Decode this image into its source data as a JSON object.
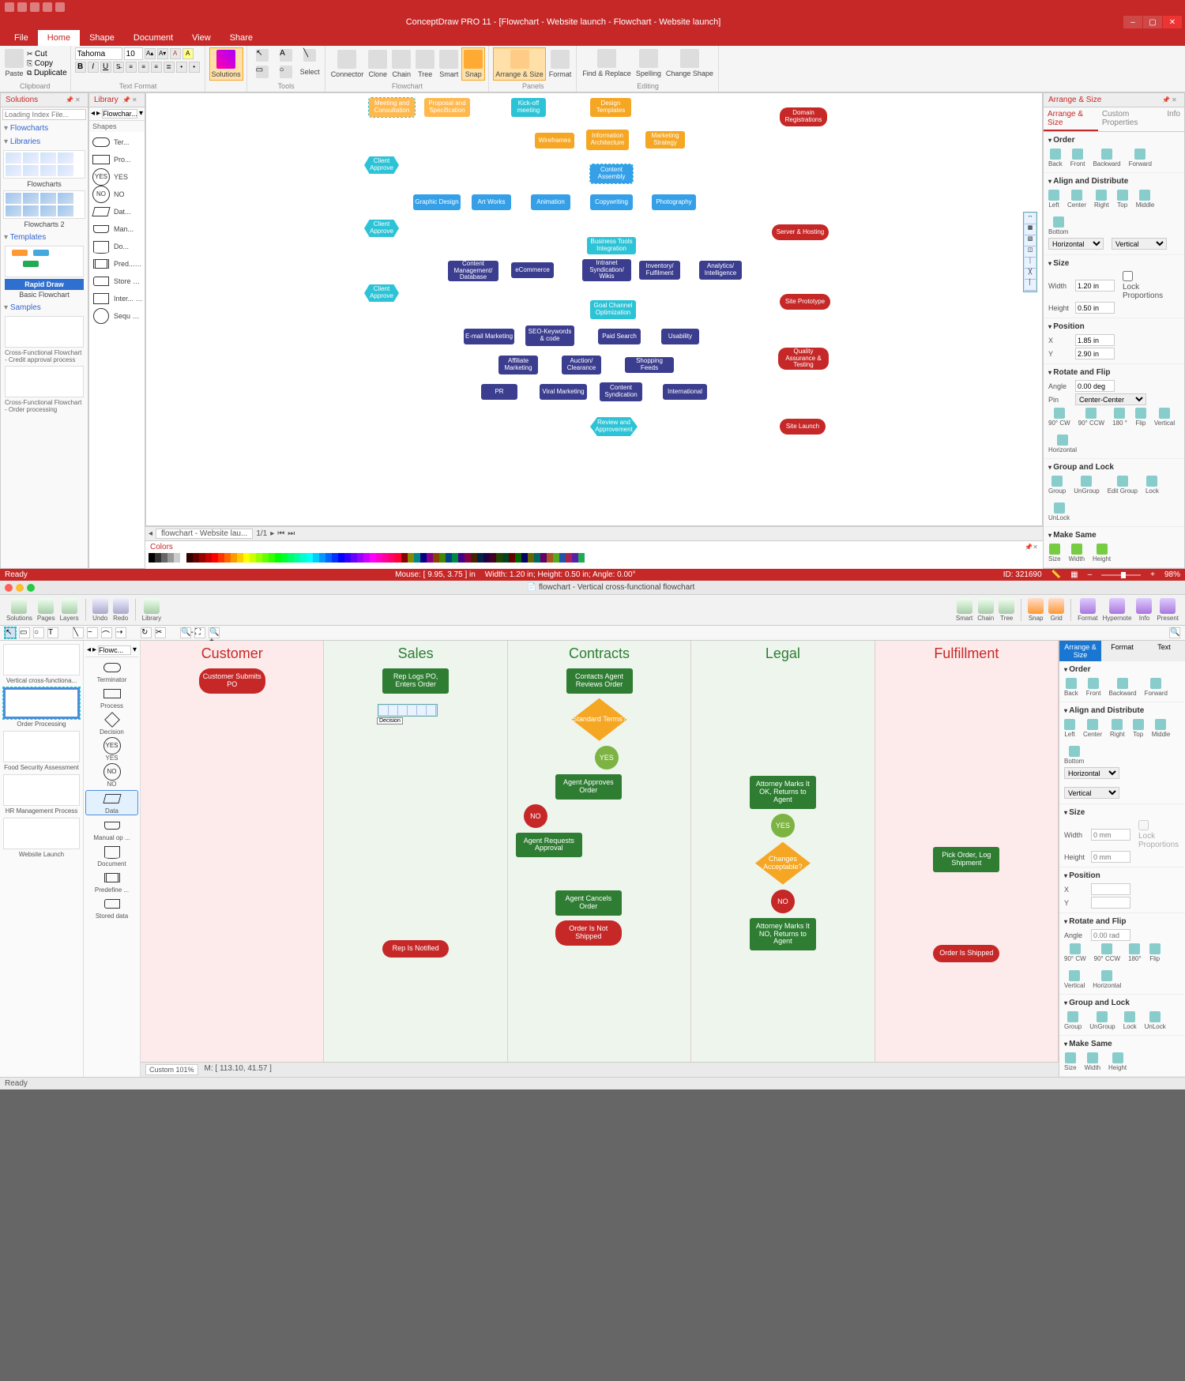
{
  "app1": {
    "title": "ConceptDraw PRO 11 - [Flowchart - Website launch - Flowchart - Website launch]",
    "qat": [
      "new",
      "open",
      "save",
      "undo",
      "redo"
    ],
    "tabs": [
      "File",
      "Home",
      "Shape",
      "Document",
      "View",
      "Share"
    ],
    "tab_active": "Home",
    "ribbon": {
      "paste": "Paste",
      "cut": "Cut",
      "copy": "Copy",
      "dup": "Duplicate",
      "clipboard": "Clipboard",
      "font_name": "Tahoma",
      "font_size": "10",
      "textformat": "Text Format",
      "solutions": "Solutions",
      "select": "Select",
      "tools": "Tools",
      "connector": "Connector",
      "clone": "Clone",
      "chain": "Chain",
      "tree": "Tree",
      "smart": "Smart",
      "snap": "Snap",
      "flowchart_grp": "Flowchart",
      "arrange": "Arrange & Size",
      "format": "Format",
      "panels": "Panels",
      "find": "Find & Replace",
      "spell": "Spelling",
      "change": "Change Shape",
      "editing": "Editing"
    },
    "solutions_panel": {
      "title": "Solutions",
      "search_ph": "Loading Index File...",
      "cat1": "Flowcharts",
      "cat2": "Libraries",
      "lib1": "Flowcharts",
      "lib2": "Flowcharts 2",
      "cat3": "Templates",
      "tpl1": "Basic Flowchart",
      "rapid": "Rapid Draw",
      "cat4": "Samples",
      "s1": "Cross-Functional Flowchart - Credit approval process",
      "s2": "Cross-Functional Flowchart - Order processing"
    },
    "library_panel": {
      "title": "Library",
      "filter": "Flowchar...",
      "shapes_tab": "Shapes",
      "sh": [
        "Ter...",
        "Pro...",
        "YES",
        "NO",
        "Dat...",
        "Man...",
        "Do...",
        "Pred... eff...",
        "Store d d...",
        "Inter... nal ...",
        "Sequ en..."
      ]
    },
    "flow": {
      "meeting": "Meeting and Consultation",
      "proposal": "Proposal and Specification",
      "kickoff": "Kick-off meeting",
      "design": "Design Templates",
      "wire": "Wireframes",
      "infoarch": "Information Architecture",
      "marketing": "Marketing Strategy",
      "domain": "Domain Registrations",
      "client": "Client Approve",
      "content": "Content Assembly",
      "graphic": "Graphic Design",
      "art": "Art Works",
      "anim": "Animation",
      "copy": "Copywriting",
      "photo": "Photography",
      "server": "Server & Hosting",
      "biztool": "Business Tools Integration",
      "cms": "Content Management/ Database",
      "ecom": "eCommerce",
      "intra": "Intranet Syndication/ Wikis",
      "inv": "Inventory/ Fulfilment",
      "analytics": "Analytics/ Intelligence",
      "goal": "Goal Channel Optimization",
      "siteproto": "Site Prototype",
      "email": "E-mail Marketing",
      "seo": "SEO-Keywords & code",
      "paid": "Paid Search",
      "usab": "Usability",
      "affil": "Affiliate Marketing",
      "auction": "Auction/ Clearance",
      "shop": "Shopping Feeds",
      "qat": "Quality Assurance & Testing",
      "pr": "PR",
      "viral": "Viral Marketing",
      "synd": "Content Syndication",
      "intl": "International",
      "review": "Review and Approvement",
      "launch": "Site Launch"
    },
    "doc_tab": "flowchart - Website lau...",
    "doc_page": "1/1",
    "colors": "Colors",
    "props": {
      "title": "Arrange & Size",
      "t1": "Arrange & Size",
      "t2": "Custom Properties",
      "t3": "Info",
      "order": "Order",
      "order_btns": [
        "Back",
        "Front",
        "Backward",
        "Forward"
      ],
      "align": "Align and Distribute",
      "al_btns": [
        "Left",
        "Center",
        "Right",
        "Top",
        "Middle",
        "Bottom"
      ],
      "horiz": "Horizontal",
      "vert": "Vertical",
      "size": "Size",
      "width": "Width",
      "width_v": "1.20 in",
      "height": "Height",
      "height_v": "0.50 in",
      "lock": "Lock Proportions",
      "pos": "Position",
      "x": "X",
      "x_v": "1.85 in",
      "y": "Y",
      "y_v": "2.90 in",
      "rot": "Rotate and Flip",
      "angle": "Angle",
      "angle_v": "0.00 deg",
      "pin": "Pin",
      "pin_v": "Center-Center",
      "rot_btns": [
        "90° CW",
        "90° CCW",
        "180 °",
        "Flip",
        "Vertical",
        "Horizontal"
      ],
      "grp": "Group and Lock",
      "grp_btns": [
        "Group",
        "UnGroup",
        "Edit Group",
        "Lock",
        "UnLock"
      ],
      "same": "Make Same",
      "same_btns": [
        "Size",
        "Width",
        "Height"
      ]
    },
    "status": {
      "ready": "Ready",
      "mouse": "Mouse: [ 9.95, 3.75 ] in",
      "dims": "Width: 1.20 in; Height: 0.50 in; Angle: 0.00°",
      "id": "ID: 321690",
      "zoom": "98%"
    }
  },
  "app2": {
    "title": "flowchart - Vertical cross-functional flowchart",
    "toolbar": [
      "Solutions",
      "Pages",
      "Layers",
      "Undo",
      "Redo",
      "Library",
      "Smart",
      "Chain",
      "Tree",
      "Snap",
      "Grid",
      "Format",
      "Hypernote",
      "Info",
      "Present"
    ],
    "sol": [
      "Vertical cross-functiona...",
      "Order Processing",
      "Food Security Assessment",
      "HR Management Process",
      "Website Launch"
    ],
    "lib_filter": "Flowc...",
    "shapes": [
      "Terminator",
      "Process",
      "Decision",
      "YES",
      "NO",
      "Data",
      "Manual op ...",
      "Document",
      "Predefine ...",
      "Stored data"
    ],
    "lanes": [
      "Customer",
      "Sales",
      "Contracts",
      "Legal",
      "Fulfillment"
    ],
    "nodes": {
      "submit": "Customer Submits PO",
      "replog": "Rep Logs PO, Enters Order",
      "contacts": "Contacts Agent Reviews Order",
      "std": "Standard Terms?",
      "decision_lbl": "Decision",
      "yes": "YES",
      "no": "NO",
      "approves": "Agent Approves Order",
      "markok": "Attorney Marks It OK, Returns to Agent",
      "requests": "Agent Requests Approval",
      "changes": "Changes Acceptable?",
      "pick": "Pick Order, Log Shipment",
      "cancels": "Agent Cancels Order",
      "markno": "Attorney Marks It NO, Returns to Agent",
      "repnot": "Rep Is Notified",
      "notship": "Order Is Not Shipped",
      "shipped": "Order Is Shipped"
    },
    "props": {
      "t1": "Arrange & Size",
      "t2": "Format",
      "t3": "Text",
      "order": "Order",
      "order_btns": [
        "Back",
        "Front",
        "Backward",
        "Forward"
      ],
      "align": "Align and Distribute",
      "al_btns": [
        "Left",
        "Center",
        "Right",
        "Top",
        "Middle",
        "Bottom"
      ],
      "horiz": "Horizontal",
      "vert": "Vertical",
      "size": "Size",
      "width": "Width",
      "w_ph": "0 mm",
      "height": "Height",
      "h_ph": "0 mm",
      "lock": "Lock Proportions",
      "pos": "Position",
      "x": "X",
      "y": "Y",
      "rot": "Rotate and Flip",
      "angle": "Angle",
      "angle_ph": "0.00 rad",
      "rot_btns": [
        "90° CW",
        "90° CCW",
        "180°",
        "Flip",
        "Vertical",
        "Horizontal"
      ],
      "grp": "Group and Lock",
      "grp_btns": [
        "Group",
        "UnGroup",
        "Lock",
        "UnLock"
      ],
      "same": "Make Same",
      "same_btns": [
        "Size",
        "Width",
        "Height"
      ]
    },
    "status": {
      "ready": "Ready",
      "custom": "Custom 101%",
      "mouse": "M: [ 113.10, 41.57 ]"
    }
  }
}
